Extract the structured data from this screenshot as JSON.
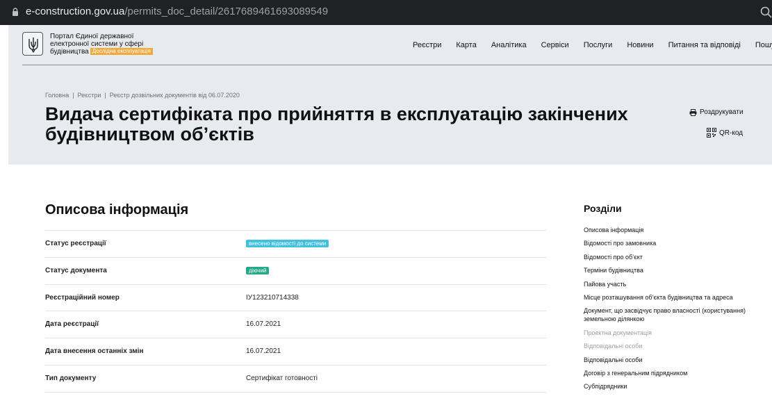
{
  "browser": {
    "domain": "e-construction.gov.ua",
    "path": "/permits_doc_detail/2617689461693089549"
  },
  "portal": {
    "title": "Портал Єдиної державної електронної системи у сфері будівництва",
    "beta_badge": "Дослідна експлуатація"
  },
  "nav": {
    "items": [
      "Реєстри",
      "Карта",
      "Аналітика",
      "Сервіси",
      "Послуги",
      "Новини",
      "Питання та відповіді",
      "Пошук"
    ]
  },
  "breadcrumb": [
    "Головна",
    "Реєстри",
    "Реєстр дозвільних документів від 06.07.2020"
  ],
  "page": {
    "title": "Видача сертифіката про прийняття в експлуатацію закінчених будівництвом об’єктів",
    "print_label": "Роздрукувати",
    "qr_label": "QR-код"
  },
  "info": {
    "title": "Описова інформація",
    "rows": [
      {
        "label": "Статус реєстрації",
        "value": "внесено відомості до системи"
      },
      {
        "label": "Статус документа",
        "value": "діючий"
      },
      {
        "label": "Реєстраційний номер",
        "value": "ІУ123210714338"
      },
      {
        "label": "Дата реєстрації",
        "value": "16.07.2021"
      },
      {
        "label": "Дата внесення останніх змін",
        "value": "16.07.2021"
      },
      {
        "label": "Тип документу",
        "value": "Сертифікат готовності"
      }
    ],
    "badge_colors": {
      "registration": "#3fc0df",
      "status": "#25a98b"
    }
  },
  "sections": {
    "title": "Розділи",
    "items": [
      "Описова інформація",
      "Відомості про замовника",
      "Відомості про об’єкт",
      "Терміни будівництва",
      "Пайова участь",
      "Місце розташування об’єкта будівництва та адреса",
      "Документ, що засвідчує право власності (користування) земельною ділянкою",
      "Проектна документація",
      "Відповідальні особи",
      "Відповідальні особи",
      "Договір з генеральним підрядником",
      "Субпідрядники"
    ]
  }
}
